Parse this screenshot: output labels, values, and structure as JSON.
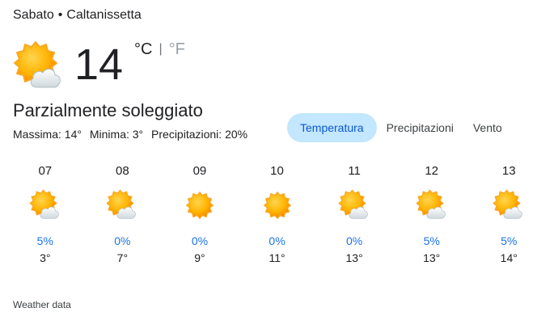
{
  "header": {
    "day": "Sabato",
    "separator": "•",
    "location": "Caltanissetta"
  },
  "current": {
    "temp": "14",
    "unit_c": "°C",
    "unit_sep": "|",
    "unit_f": "°F",
    "icon": "partly-cloudy-icon",
    "condition": "Parzialmente soleggiato",
    "max": "Massima: 14°",
    "min": "Minima: 3°",
    "precip": "Precipitazioni: 20%"
  },
  "tabs": [
    "Temperatura",
    "Precipitazioni",
    "Vento"
  ],
  "active_tab": "Temperatura",
  "hours": [
    {
      "time": "07",
      "icon": "partly-cloudy-icon",
      "precip": "5%",
      "temp": "3°"
    },
    {
      "time": "08",
      "icon": "partly-cloudy-icon",
      "precip": "0%",
      "temp": "7°"
    },
    {
      "time": "09",
      "icon": "sunny-icon",
      "precip": "0%",
      "temp": "9°"
    },
    {
      "time": "10",
      "icon": "sunny-icon",
      "precip": "0%",
      "temp": "11°"
    },
    {
      "time": "11",
      "icon": "partly-cloudy-icon",
      "precip": "0%",
      "temp": "13°"
    },
    {
      "time": "12",
      "icon": "partly-cloudy-icon",
      "precip": "5%",
      "temp": "13°"
    },
    {
      "time": "13",
      "icon": "partly-cloudy-icon",
      "precip": "5%",
      "temp": "14°"
    }
  ],
  "footer": "Weather data",
  "colors": {
    "active_tab_bg": "#c2e7ff",
    "active_tab_text": "#0b57d0",
    "precip_text": "#1a73e8",
    "sun": "#f9a825",
    "sun_dark": "#f57c00",
    "cloud": "#eceff1"
  }
}
